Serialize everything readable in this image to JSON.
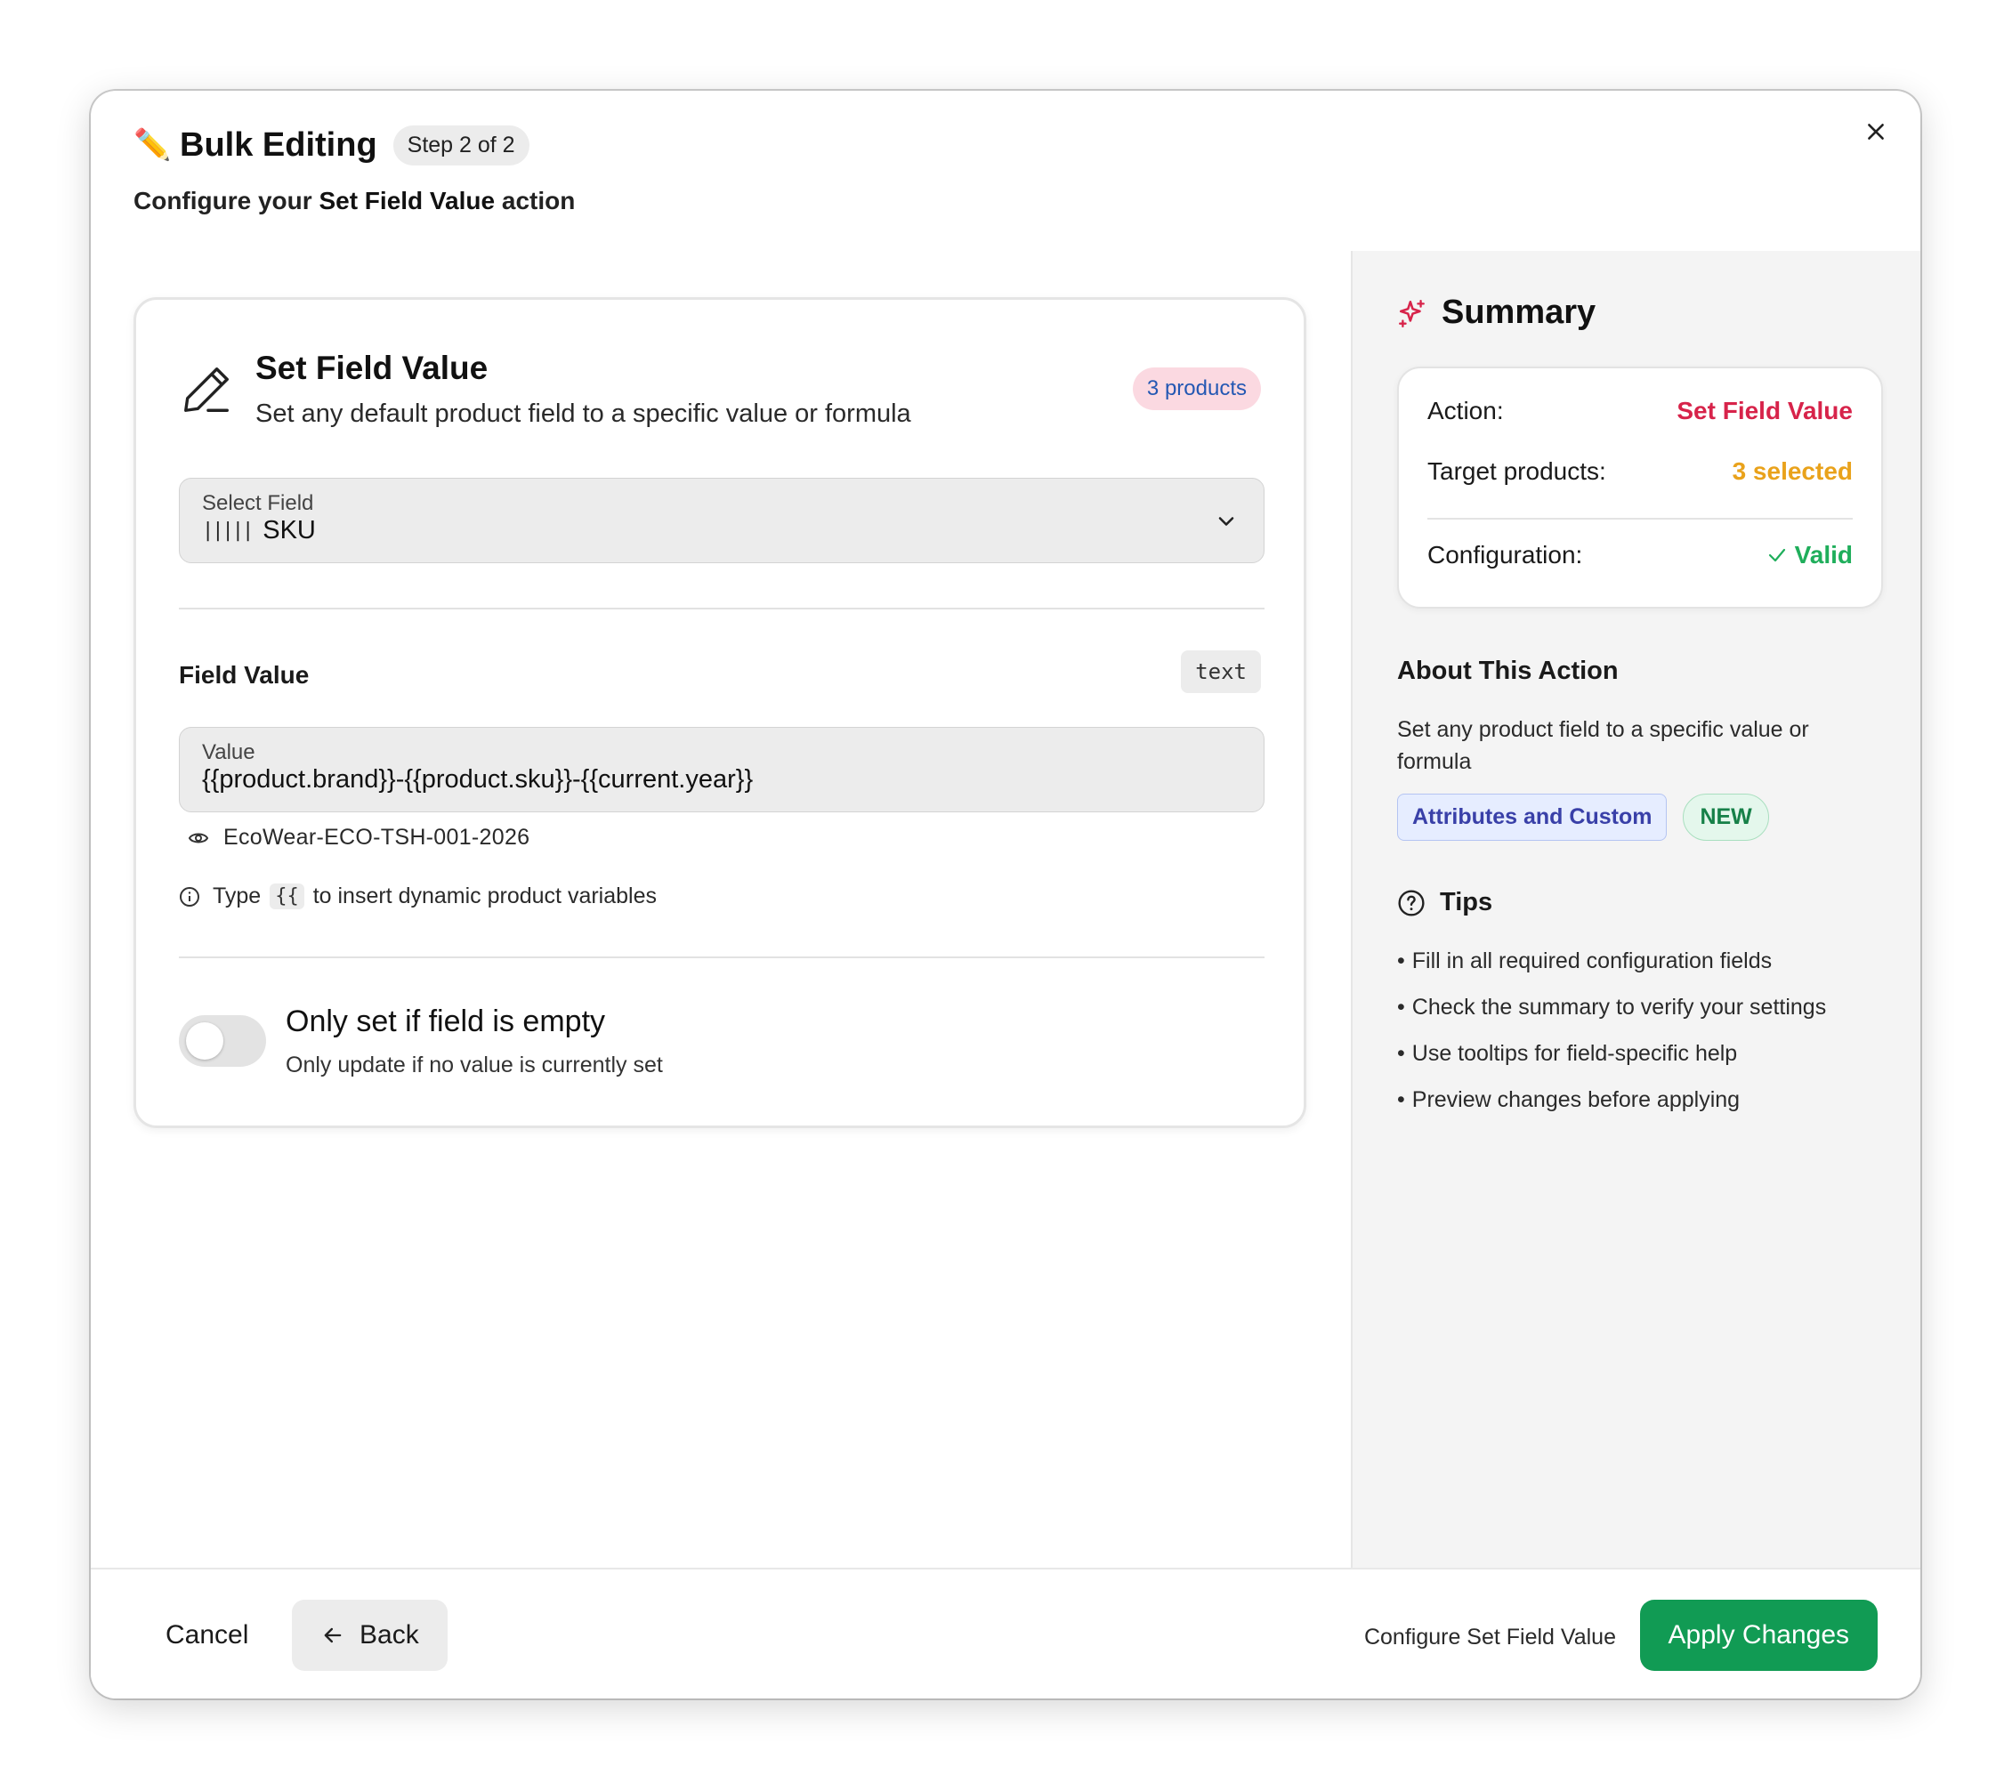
{
  "header": {
    "title": "Bulk Editing",
    "step": "Step 2 of 2",
    "subtitle_prefix": "Configure your ",
    "subtitle_bold": "Set Field Value",
    "subtitle_suffix": " action"
  },
  "card": {
    "title": "Set Field Value",
    "description": "Set any default product field to a specific value or formula",
    "products_badge": "3 products",
    "select_field": {
      "label": "Select Field",
      "value": "SKU",
      "icon": "barcode-icon"
    },
    "field_value": {
      "label": "Field Value",
      "type": "text",
      "input_label": "Value",
      "input_value": "{{product.brand}}-{{product.sku}}-{{current.year}}",
      "preview": "EcoWear-ECO-TSH-001-2026"
    },
    "hint": {
      "prefix": "Type",
      "code": "{{",
      "suffix": "to insert dynamic product variables"
    },
    "toggle": {
      "title": "Only set if field is empty",
      "description": "Only update if no value is currently set",
      "enabled": false
    }
  },
  "summary": {
    "title": "Summary",
    "rows": [
      {
        "key": "Action:",
        "value": "Set Field Value",
        "color": "#d7234a"
      },
      {
        "key": "Target products:",
        "value": "3 selected",
        "color": "#e9a21b"
      },
      {
        "key": "Configuration:",
        "value": "Valid",
        "color": "#1fae5b"
      }
    ]
  },
  "about": {
    "title": "About This Action",
    "description": "Set any product field to a specific value or formula",
    "badge": "Attributes and Custom",
    "new_badge": "NEW"
  },
  "tips": {
    "title": "Tips",
    "items": [
      "Fill in all required configuration fields",
      "Check the summary to verify your settings",
      "Use tooltips for field-specific help",
      "Preview changes before applying"
    ]
  },
  "footer": {
    "cancel": "Cancel",
    "back": "Back",
    "note": "Configure Set Field Value",
    "apply": "Apply Changes"
  },
  "colors": {
    "accent_green": "#119b54",
    "accent_pink": "#d7234a",
    "accent_orange": "#e9a21b"
  }
}
